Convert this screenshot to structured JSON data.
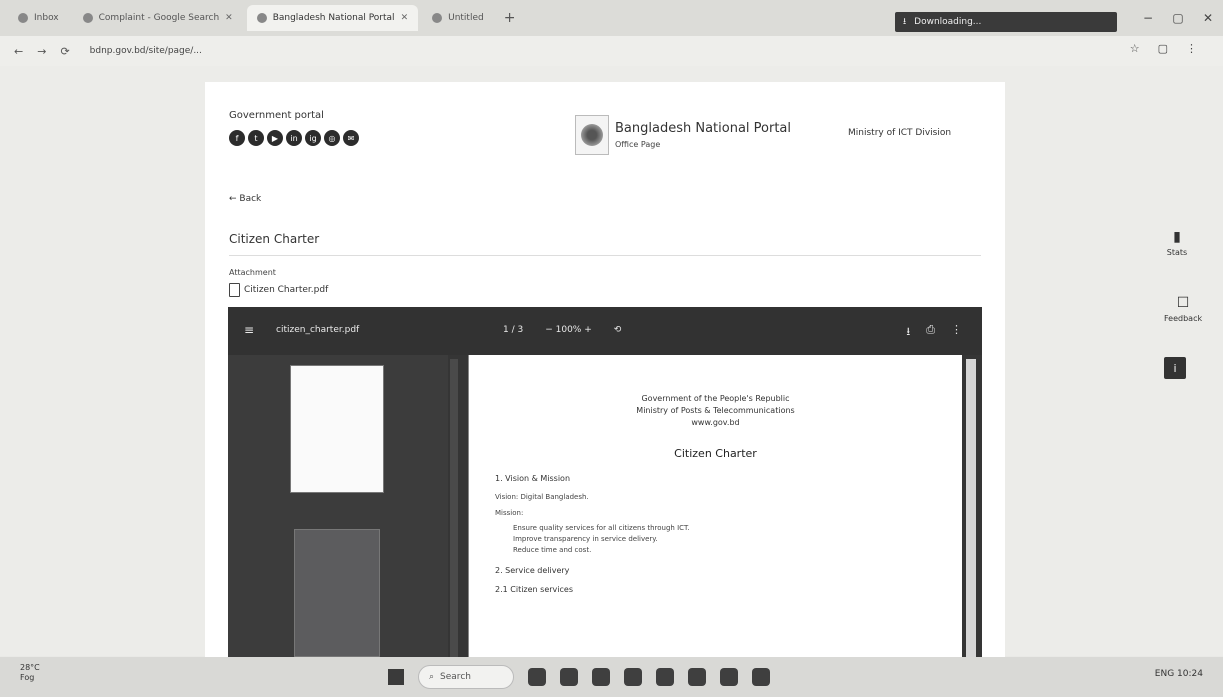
{
  "browser": {
    "tabs": [
      {
        "label": "Inbox"
      },
      {
        "label": "Complaint - Google Search"
      },
      {
        "label": "Bangladesh National Portal"
      },
      {
        "label": "Untitled"
      }
    ],
    "new_tab": "+",
    "download_text": "Downloading...",
    "controls": {
      "minimize": "−",
      "maximize": "▢",
      "close": "✕"
    },
    "nav": {
      "back": "←",
      "forward": "→",
      "reload": "⟳"
    },
    "url": "bdnp.gov.bd/site/page/...",
    "right_icons": [
      "☆",
      "▢",
      "⋮"
    ]
  },
  "header": {
    "logo_text": "Government portal",
    "socials": [
      "f",
      "t",
      "▶",
      "in",
      "ig",
      "◎",
      "✉"
    ],
    "portal_title": "Bangladesh National Portal",
    "portal_sub": "Office Page",
    "right_text": "Ministry of ICT Division"
  },
  "page": {
    "back_link": "← Back",
    "title": "Citizen Charter",
    "attach_label": "Attachment",
    "attach_file": "Citizen Charter.pdf"
  },
  "viewer": {
    "menu": "≡",
    "filename": "citizen_charter.pdf",
    "page_info": "1 / 3",
    "zoom": "− 100% +",
    "rotate": "⟲",
    "download": "⭳",
    "print": "⎙",
    "more": "⋮",
    "doc": {
      "line1": "Government of the People's Republic",
      "line2": "Ministry of Posts & Telecommunications",
      "line3": "www.gov.bd",
      "title": "Citizen Charter",
      "h1": "1. Vision & Mission",
      "p1": "Vision: Digital Bangladesh.",
      "p2": "Mission:",
      "li1": "Ensure quality services for all citizens through ICT.",
      "li2": "Improve transparency in service delivery.",
      "li3": "Reduce time and cost.",
      "h2": "2. Service delivery",
      "h3": "2.1 Citizen services"
    }
  },
  "side": {
    "item1_label": "Stats",
    "item2_label": "Feedback",
    "item3_icon": "i"
  },
  "taskbar": {
    "weather_temp": "28°C",
    "weather_desc": "Fog",
    "search": "Search",
    "tray": "ENG 10:24"
  }
}
